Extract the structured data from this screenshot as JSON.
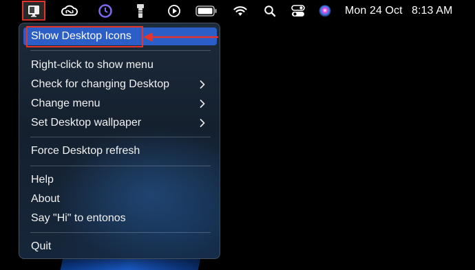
{
  "menubar": {
    "icons": [
      {
        "name": "desktop-app-icon"
      },
      {
        "name": "creative-cloud-icon"
      },
      {
        "name": "timing-app-icon"
      },
      {
        "name": "flashlight-icon"
      },
      {
        "name": "play-icon"
      },
      {
        "name": "battery-icon"
      },
      {
        "name": "wifi-icon"
      },
      {
        "name": "search-icon"
      },
      {
        "name": "control-center-icon"
      },
      {
        "name": "siri-icon"
      }
    ],
    "date": "Mon 24 Oct",
    "time": "8:13 AM"
  },
  "menu": {
    "groups": [
      {
        "items": [
          {
            "label": "Show Desktop Icons",
            "highlighted": true,
            "submenu": false
          }
        ]
      },
      {
        "items": [
          {
            "label": "Right-click to show menu",
            "submenu": false
          },
          {
            "label": "Check for changing Desktop",
            "submenu": true
          },
          {
            "label": "Change menu",
            "submenu": true
          },
          {
            "label": "Set Desktop wallpaper",
            "submenu": true
          }
        ]
      },
      {
        "items": [
          {
            "label": "Force Desktop refresh",
            "submenu": false
          }
        ]
      },
      {
        "items": [
          {
            "label": "Help",
            "submenu": false
          },
          {
            "label": "About",
            "submenu": false
          },
          {
            "label": "Say \"Hi\" to entonos",
            "submenu": false
          }
        ]
      },
      {
        "items": [
          {
            "label": "Quit",
            "submenu": false
          }
        ]
      }
    ]
  },
  "colors": {
    "highlight": "#2b5fc7",
    "annotation": "#e8332a"
  }
}
